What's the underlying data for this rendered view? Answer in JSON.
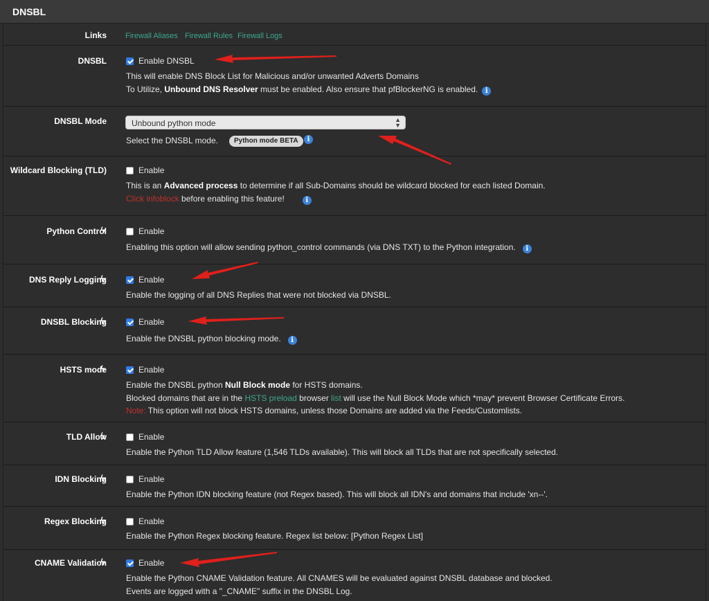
{
  "panel": {
    "title": "DNSBL"
  },
  "links": {
    "label": "Links",
    "items": [
      "Firewall Aliases",
      "Firewall Rules",
      "Firewall Logs"
    ]
  },
  "dnsbl": {
    "label": "DNSBL",
    "checked": true,
    "checkbox_label": "Enable DNSBL",
    "help1": "This will enable DNS Block List for Malicious and/or unwanted Adverts Domains",
    "help2_pre": "To Utilize, ",
    "help2_bold": "Unbound DNS Resolver",
    "help2_post": " must be enabled. Also ensure that pfBlockerNG is enabled."
  },
  "mode": {
    "label": "DNSBL Mode",
    "selected": "Unbound python mode",
    "help": "Select the DNSBL mode.",
    "badge": "Python mode BETA"
  },
  "wildcard": {
    "label": "Wildcard Blocking (TLD)",
    "checked": false,
    "checkbox_label": "Enable",
    "help1_pre": "This is an ",
    "help1_bold": "Advanced process",
    "help1_post": " to determine if all Sub-Domains should be wildcard blocked for each listed Domain.",
    "help2_red": "Click infoblock",
    "help2_post": " before enabling this feature!"
  },
  "python_control": {
    "label": "Python Control",
    "checked": false,
    "checkbox_label": "Enable",
    "help": "Enabling this option will allow sending python_control commands (via DNS TXT) to the Python integration."
  },
  "reply_logging": {
    "label": "DNS Reply Logging",
    "checked": true,
    "checkbox_label": "Enable",
    "help": "Enable the logging of all DNS Replies that were not blocked via DNSBL."
  },
  "dnsbl_blocking": {
    "label": "DNSBL Blocking",
    "checked": true,
    "checkbox_label": "Enable",
    "help": "Enable the DNSBL python blocking mode."
  },
  "hsts": {
    "label": "HSTS mode",
    "checked": true,
    "checkbox_label": "Enable",
    "help1_pre": "Enable the DNSBL python ",
    "help1_bold": "Null Block mode",
    "help1_post": " for HSTS domains.",
    "help2_pre": "Blocked domains that are in the ",
    "help2_link1": "HSTS preload",
    "help2_mid": " browser ",
    "help2_link2": "list",
    "help2_post": " will use the Null Block Mode which *may* prevent Browser Certificate Errors.",
    "help3_red": "Note:",
    "help3_post": " This option will not block HSTS domains, unless those Domains are added via the Feeds/Customlists."
  },
  "tld_allow": {
    "label": "TLD Allow",
    "checked": false,
    "checkbox_label": "Enable",
    "help": "Enable the Python TLD Allow feature (1,546 TLDs available). This will block all TLDs that are not specifically selected."
  },
  "idn": {
    "label": "IDN Blocking",
    "checked": false,
    "checkbox_label": "Enable",
    "help": "Enable the Python IDN blocking feature (not Regex based). This will block all IDN's and domains that include 'xn--'."
  },
  "regex": {
    "label": "Regex Blocking",
    "checked": false,
    "checkbox_label": "Enable",
    "help": "Enable the Python Regex blocking feature. Regex list below: [Python Regex List]"
  },
  "cname": {
    "label": "CNAME Validation",
    "checked": true,
    "checkbox_label": "Enable",
    "help1": "Enable the Python CNAME Validation feature. All CNAMES will be evaluated against DNSBL database and blocked.",
    "help2": "Events are logged with a \"_CNAME\" suffix in the DNSBL Log."
  },
  "icons": {
    "bolt": "lightning-bolt-icon",
    "info": "info-circle-icon",
    "arrow": "red-arrow-annotation",
    "select_caret": "up-down-caret-icon"
  },
  "colors": {
    "background": "#2d2d2d",
    "link": "#3ca88e",
    "checkbox_on": "#2f7be5",
    "info": "#3b82d8",
    "arrow": "#e0201b",
    "note_red": "#c0302e"
  }
}
